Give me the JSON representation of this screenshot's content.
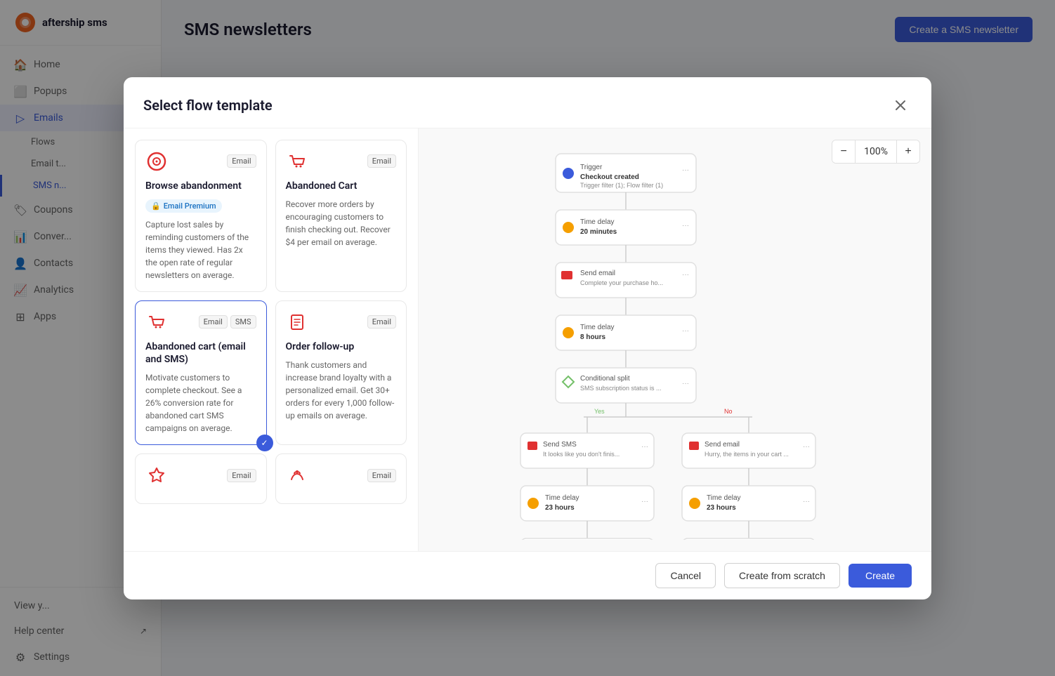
{
  "app": {
    "name": "aftership sms"
  },
  "sidebar": {
    "items": [
      {
        "id": "home",
        "label": "Home",
        "icon": "🏠"
      },
      {
        "id": "popups",
        "label": "Popups",
        "icon": "⬜"
      },
      {
        "id": "emails",
        "label": "Emails",
        "icon": "▷",
        "active": true
      },
      {
        "id": "flows",
        "label": "Flows",
        "sub": true
      },
      {
        "id": "email-t",
        "label": "Email t...",
        "sub": true
      },
      {
        "id": "sms-n",
        "label": "SMS n...",
        "sub": true,
        "active": true
      },
      {
        "id": "coupons",
        "label": "Coupons",
        "icon": "🏷"
      },
      {
        "id": "conversions",
        "label": "Conver...",
        "icon": "📊"
      },
      {
        "id": "contacts",
        "label": "Contacts",
        "icon": "👤"
      },
      {
        "id": "analytics",
        "label": "Analytics",
        "icon": "📈"
      },
      {
        "id": "apps",
        "label": "Apps",
        "icon": "⊞"
      }
    ],
    "bottom_items": [
      {
        "id": "view-y",
        "label": "View y..."
      },
      {
        "id": "help",
        "label": "Help center"
      },
      {
        "id": "settings",
        "label": "Settings"
      }
    ]
  },
  "page": {
    "title": "SMS newsletters",
    "create_button": "Create a SMS newsletter"
  },
  "modal": {
    "title": "Select flow template",
    "close_label": "×",
    "zoom": {
      "value": "100%",
      "minus_label": "−",
      "plus_label": "+"
    },
    "templates": [
      {
        "id": "browse-abandonment",
        "icon_color": "#e03131",
        "icon_type": "target",
        "tags": [
          "Email"
        ],
        "title": "Browse abandonment",
        "premium": true,
        "premium_label": "Email Premium",
        "description": "Capture lost sales by reminding customers of the items they viewed. Has 2x the open rate of regular newsletters on average.",
        "selected": false
      },
      {
        "id": "abandoned-cart",
        "icon_color": "#e03131",
        "icon_type": "cart",
        "tags": [
          "Email"
        ],
        "title": "Abandoned Cart",
        "premium": false,
        "description": "Recover more orders by encouraging customers to finish checking out. Recover $4 per email on average.",
        "selected": false
      },
      {
        "id": "abandoned-cart-email-sms",
        "icon_color": "#e03131",
        "icon_type": "cart",
        "tags": [
          "Email",
          "SMS"
        ],
        "title": "Abandoned cart (email and SMS)",
        "premium": false,
        "description": "Motivate customers to complete checkout. See a 26% conversion rate for abandoned cart SMS campaigns on average.",
        "selected": true
      },
      {
        "id": "order-follow-up",
        "icon_color": "#e03131",
        "icon_type": "receipt",
        "tags": [
          "Email"
        ],
        "title": "Order follow-up",
        "premium": false,
        "description": "Thank customers and increase brand loyalty with a personalized email. Get 30+ orders for every 1,000 follow-up emails on average.",
        "selected": false
      },
      {
        "id": "card5",
        "icon_color": "#e03131",
        "icon_type": "bell",
        "tags": [
          "Email"
        ],
        "title": "...",
        "premium": false,
        "description": "",
        "selected": false
      },
      {
        "id": "card6",
        "icon_color": "#e03131",
        "icon_type": "thumb",
        "tags": [
          "Email"
        ],
        "title": "...",
        "premium": false,
        "description": "",
        "selected": false
      }
    ],
    "footer": {
      "cancel_label": "Cancel",
      "scratch_label": "Create from scratch",
      "create_label": "Create"
    }
  }
}
